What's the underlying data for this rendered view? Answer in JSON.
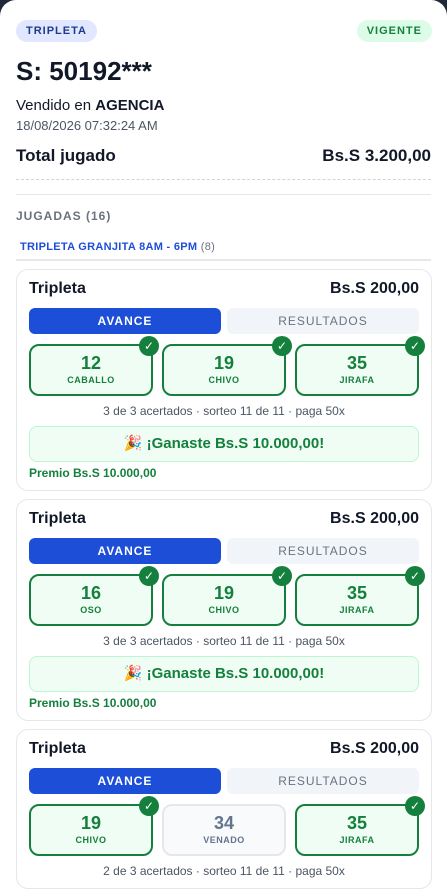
{
  "ticket": {
    "type_badge": "TRIPLETA",
    "status_badge": "VIGENTE",
    "serial": "S: 50192***",
    "sold_prefix": "Vendido en",
    "sold_place": "AGENCIA",
    "datetime": "18/08/2026 07:32:24 AM",
    "total_label": "Total jugado",
    "total_value": "Bs.S 3.200,00"
  },
  "plays": {
    "title": "JUGADAS (16)",
    "draw_name": "TRIPLETA GRANJITA 8AM - 6PM",
    "draw_count": "(8)"
  },
  "colors": {
    "accent": "#1d4ed8",
    "success": "#15803d",
    "badge_type_bg": "#e0e7ff",
    "badge_status_bg": "#dcfce7"
  },
  "cards": [
    {
      "title": "Tripleta",
      "amount": "Bs.S 200,00",
      "tab_avance": "AVANCE",
      "tab_resultados": "RESULTADOS",
      "numbers": [
        {
          "n": "12",
          "animal": "CABALLO",
          "hit": true
        },
        {
          "n": "19",
          "animal": "CHIVO",
          "hit": true
        },
        {
          "n": "35",
          "animal": "JIRAFA",
          "hit": true
        }
      ],
      "summary": "3 de 3 acertados · sorteo 11 de 11 · paga 50x",
      "win": "🎉 ¡Ganaste Bs.S 10.000,00!",
      "prize": "Premio Bs.S 10.000,00"
    },
    {
      "title": "Tripleta",
      "amount": "Bs.S 200,00",
      "tab_avance": "AVANCE",
      "tab_resultados": "RESULTADOS",
      "numbers": [
        {
          "n": "16",
          "animal": "OSO",
          "hit": true
        },
        {
          "n": "19",
          "animal": "CHIVO",
          "hit": true
        },
        {
          "n": "35",
          "animal": "JIRAFA",
          "hit": true
        }
      ],
      "summary": "3 de 3 acertados · sorteo 11 de 11 · paga 50x",
      "win": "🎉 ¡Ganaste Bs.S 10.000,00!",
      "prize": "Premio Bs.S 10.000,00"
    },
    {
      "title": "Tripleta",
      "amount": "Bs.S 200,00",
      "tab_avance": "AVANCE",
      "tab_resultados": "RESULTADOS",
      "numbers": [
        {
          "n": "19",
          "animal": "CHIVO",
          "hit": true
        },
        {
          "n": "34",
          "animal": "VENADO",
          "hit": false
        },
        {
          "n": "35",
          "animal": "JIRAFA",
          "hit": true
        }
      ],
      "summary": "2 de 3 acertados · sorteo 11 de 11 · paga 50x"
    }
  ]
}
